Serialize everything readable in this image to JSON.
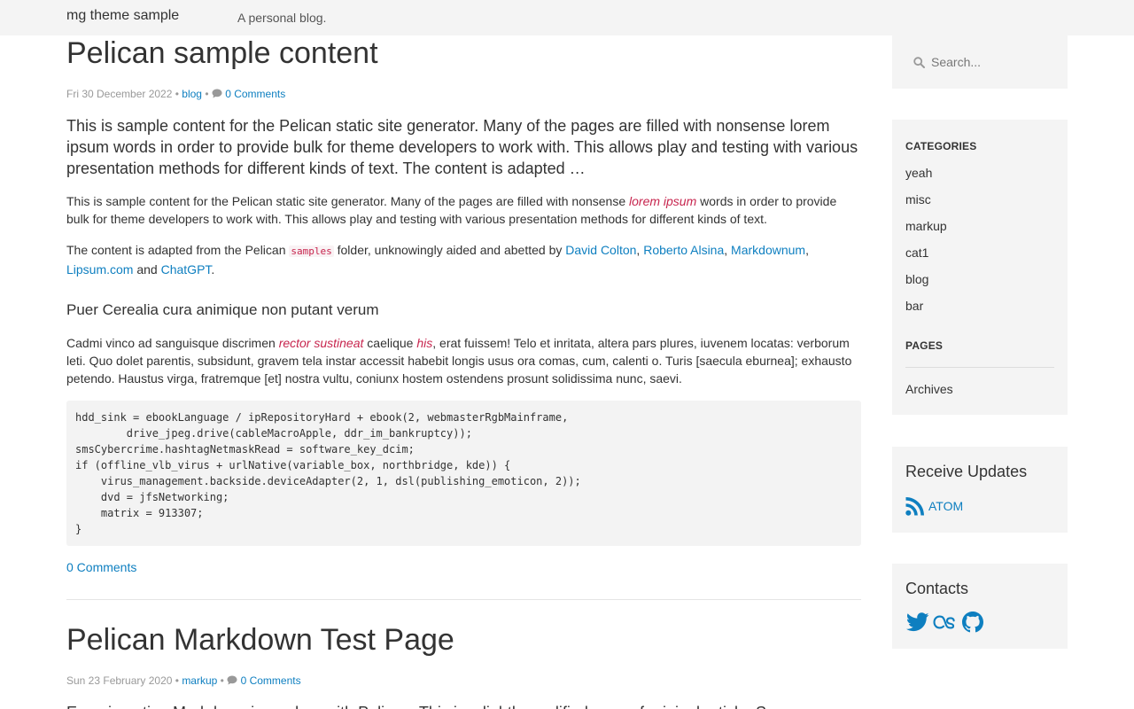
{
  "navbar": {
    "brand": "mg theme sample",
    "tagline": "A personal blog."
  },
  "posts": [
    {
      "title": "Pelican sample content",
      "date": "Fri 30 December 2022",
      "sep": "•",
      "category": "blog",
      "comments_meta": "0 Comments",
      "lead": "This is sample content for the Pelican static site generator. Many of the pages are filled with nonsense lorem ipsum words in order to provide bulk for theme developers to work with. This allows play and testing with various presentation methods for different kinds of text. The content is adapted …",
      "para1": {
        "before": "This is sample content for the Pelican static site generator. Many of the pages are filled with nonsense ",
        "emphasis": "lorem ipsum",
        "after": " words in order to provide bulk for theme developers to work with. This allows play and testing with various presentation methods for different kinds of text."
      },
      "para2": {
        "before": "The content is adapted from the Pelican ",
        "code": "samples",
        "middle": " folder, unknowingly aided and abetted by ",
        "link1": "David Colton",
        "comma1": ", ",
        "link2": "Roberto Alsina",
        "comma2": ", ",
        "link3": "Markdownum",
        "comma3": ", ",
        "link4": "Lipsum.com",
        "and": " and ",
        "link5": "ChatGPT",
        "end": "."
      },
      "subheading": "Puer Cerealia cura animique non putant verum",
      "para3": {
        "before": "Cadmi vinco ad sanguisque discrimen ",
        "emphasis1": "rector sustineat",
        "middle": " caelique ",
        "emphasis2": "his",
        "after": ", erat fuissem! Telo et inritata, altera pars plures, iuvenem locatas: verborum leti. Quo dolet parentis, subsidunt, gravem tela instar accessit habebit longis usus ora comas, cum, calenti o. Turis [saecula eburnea]; exhausto petendo. Haustus virga, fratremque [et] nostra vultu, coniunx hostem ostendens prosunt solidissima nunc, saevi."
      },
      "code_block": "hdd_sink = ebookLanguage / ipRepositoryHard + ebook(2, webmasterRgbMainframe,\n        drive_jpeg.drive(cableMacroApple, ddr_im_bankruptcy));\nsmsCybercrime.hashtagNetmaskRead = software_key_dcim;\nif (offline_vlb_virus + urlNative(variable_box, northbridge, kde)) {\n    virus_management.backside.deviceAdapter(2, 1, dsl(publishing_emoticon, 2));\n    dvd = jfsNetworking;\n    matrix = 913307;\n}",
      "comments_link": "0 Comments"
    },
    {
      "title": "Pelican Markdown Test Page",
      "date": "Sun 23 February 2020",
      "sep": "•",
      "category": "markup",
      "comments_meta": "0 Comments",
      "lead_partial": "Experimenting Markdown in markup with Pelican. This is a lightly modified copy of original article. Some"
    }
  ],
  "sidebar": {
    "search": {
      "placeholder": "Search..."
    },
    "categories_heading": "CATEGORIES",
    "categories": [
      "yeah",
      "misc",
      "markup",
      "cat1",
      "blog",
      "bar"
    ],
    "pages_heading": "PAGES",
    "pages": [
      "Archives"
    ],
    "updates_title": "Receive Updates",
    "atom_label": "ATOM",
    "contacts_title": "Contacts",
    "contacts": [
      "twitter-icon",
      "lastfm-icon",
      "github-icon"
    ]
  },
  "colors": {
    "link": "#0e7fc0",
    "emphasis": "#c7254e",
    "widget_bg": "#f4f4f4"
  }
}
